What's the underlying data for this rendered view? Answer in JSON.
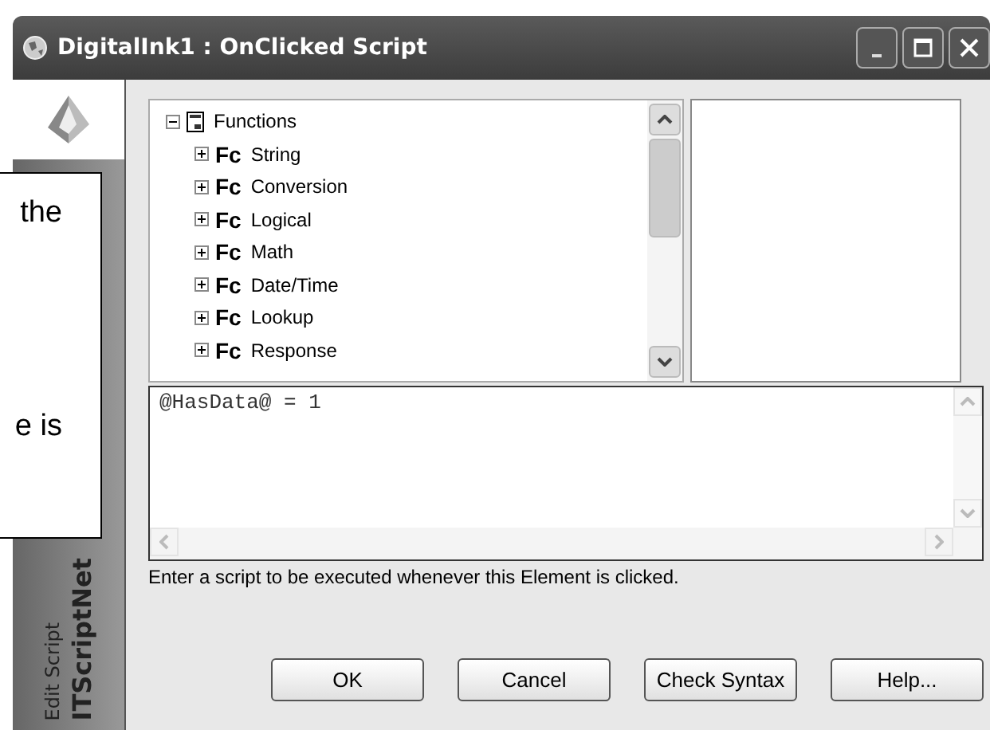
{
  "window": {
    "title": "DigitalInk1 : OnClicked Script"
  },
  "sidebar": {
    "brand": "ITScriptNet",
    "subtitle": "Edit Script"
  },
  "tree": {
    "label": "Functions",
    "expanded": true,
    "children": [
      {
        "label": "String",
        "icon_text": "Fc",
        "expanded": false
      },
      {
        "label": "Conversion",
        "icon_text": "Fc",
        "expanded": false
      },
      {
        "label": "Logical",
        "icon_text": "Fc",
        "expanded": false
      },
      {
        "label": "Math",
        "icon_text": "Fc",
        "expanded": false
      },
      {
        "label": "Date/Time",
        "icon_text": "Fc",
        "expanded": false
      },
      {
        "label": "Lookup",
        "icon_text": "Fc",
        "expanded": false
      },
      {
        "label": "Response",
        "icon_text": "Fc",
        "expanded": false
      }
    ]
  },
  "script": {
    "value": "@HasData@ = 1"
  },
  "hint": "Enter a script to be executed whenever this Element is clicked.",
  "buttons": [
    "OK",
    "Cancel",
    "Check Syntax",
    "Help..."
  ],
  "callout": {
    "lines": [
      "the",
      "e is"
    ]
  }
}
